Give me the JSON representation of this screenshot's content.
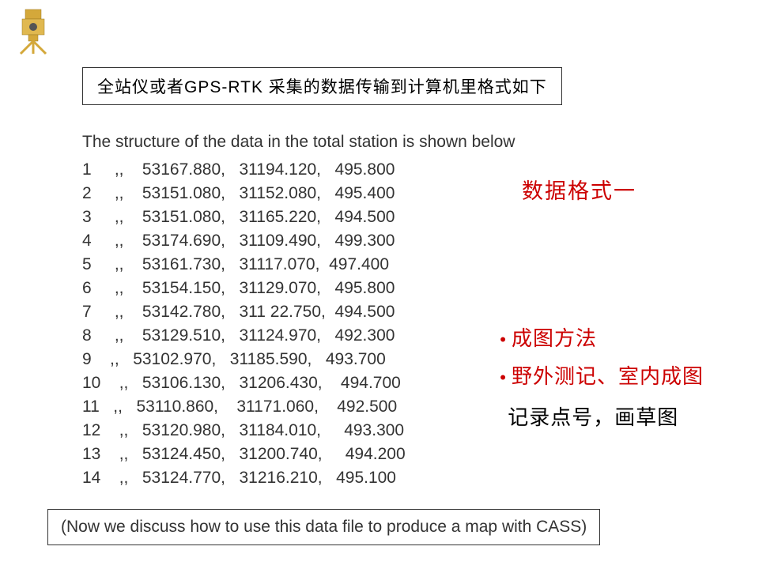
{
  "header": "全站仪或者GPS-RTK 采集的数据传输到计算机里格式如下",
  "intro": "The structure of the data in the total station is shown below",
  "rows": [
    "1     ,,    53167.880,   31194.120,   495.800",
    "2     ,,    53151.080,   31152.080,   495.400",
    "3     ,,    53151.080,   31165.220,   494.500",
    "4     ,,    53174.690,   31109.490,   499.300",
    "5     ,,    53161.730,   31117.070,  497.400",
    "6     ,,    53154.150,   31129.070,   495.800",
    "7     ,,    53142.780,   311 22.750,  494.500",
    "8     ,,    53129.510,   31124.970,   492.300",
    "9    ,,   53102.970,   31185.590,   493.700",
    "10    ,,   53106.130,   31206.430,    494.700",
    "11   ,,   53110.860,    31171.060,    492.500",
    "12    ,,   53120.980,   31184.010,     493.300",
    "13    ,,   53124.450,   31200.740,     494.200",
    "14    ,,   53124.770,   31216.210,   495.100"
  ],
  "side": {
    "format_label": "数据格式一",
    "method_title": "成图方法",
    "method_sub": "野外测记、室内成图",
    "method_note": "记录点号，画草图"
  },
  "footer": "(Now we discuss how to use this data file to produce a map  with CASS)"
}
